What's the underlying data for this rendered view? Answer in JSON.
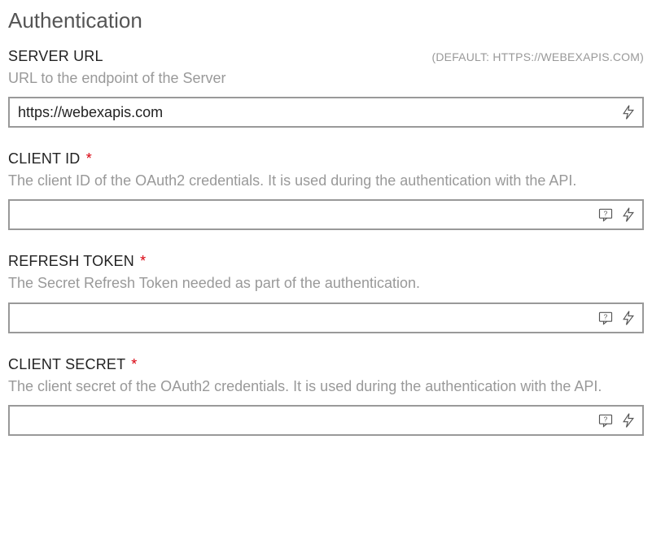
{
  "section": {
    "title": "Authentication"
  },
  "fields": {
    "serverUrl": {
      "label": "SERVER URL",
      "defaultHint": "(DEFAULT: HTTPS://WEBEXAPIS.COM)",
      "description": "URL to the endpoint of the Server",
      "value": "https://webexapis.com"
    },
    "clientId": {
      "label": "CLIENT ID",
      "required": "*",
      "description": "The client ID of the OAuth2 credentials. It is used during the authentication with the API.",
      "value": ""
    },
    "refreshToken": {
      "label": "REFRESH TOKEN",
      "required": "*",
      "description": "The Secret Refresh Token needed as part of the authentication.",
      "value": ""
    },
    "clientSecret": {
      "label": "CLIENT SECRET",
      "required": "*",
      "description": "The client secret of the OAuth2 credentials. It is used during the authentication with the API.",
      "value": ""
    }
  }
}
